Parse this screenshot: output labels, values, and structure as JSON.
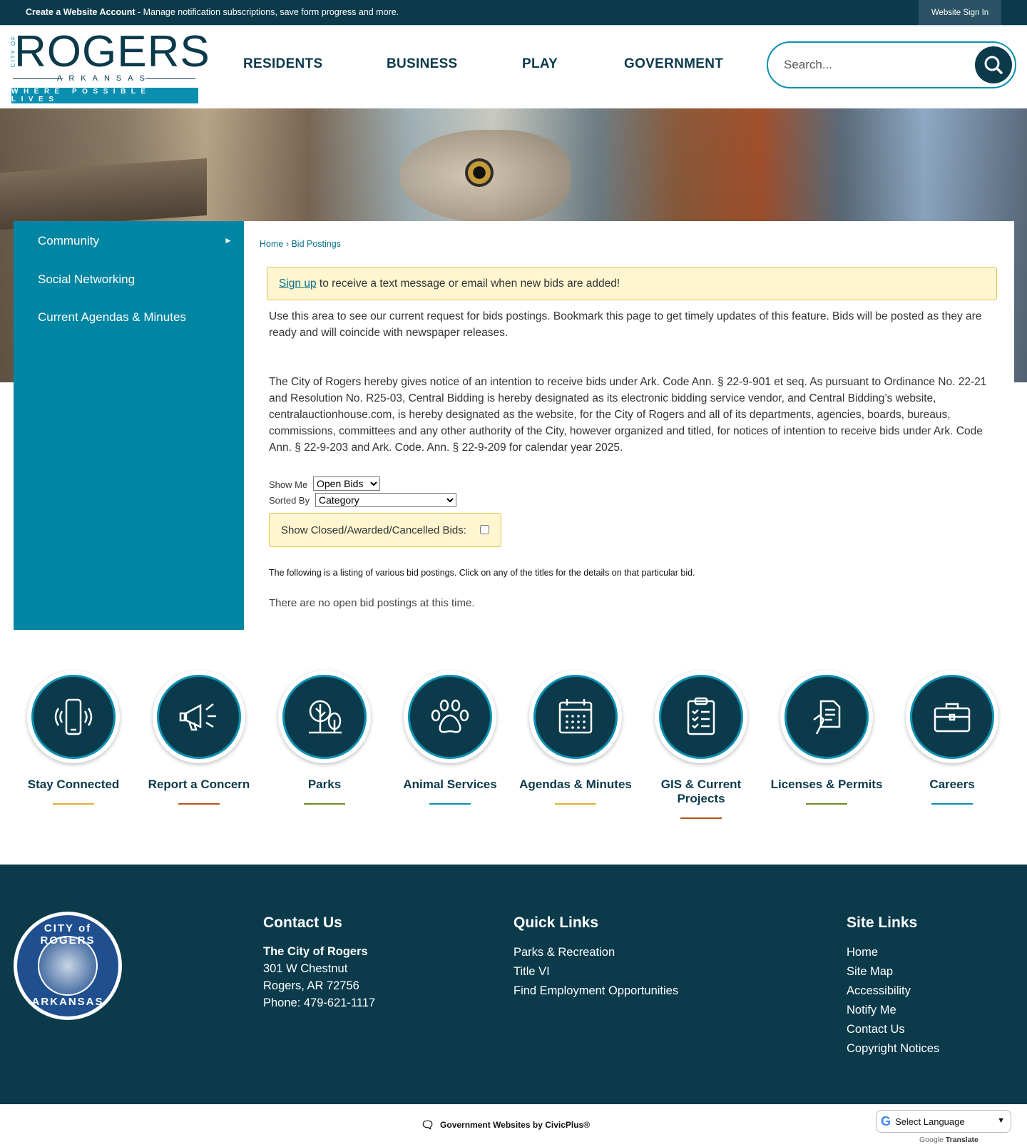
{
  "topbar": {
    "account_link": "Create a Website Account",
    "account_desc": " - Manage notification subscriptions, save form progress and more.",
    "signin": "Website Sign In"
  },
  "logo": {
    "city_of": "CITY OF",
    "name": "ROGERS",
    "state": "ARKANSAS",
    "tagline": "WHERE POSSIBLE LIVES"
  },
  "nav": {
    "items": [
      "RESIDENTS",
      "BUSINESS",
      "PLAY",
      "GOVERNMENT"
    ]
  },
  "search": {
    "placeholder": "Search..."
  },
  "sidebar": {
    "items": [
      "Community",
      "Social Networking",
      "Current Agendas & Minutes"
    ]
  },
  "breadcrumb": {
    "home": "Home",
    "sep": " › ",
    "current": "Bid Postings"
  },
  "notice": {
    "link": "Sign up",
    "text": " to receive a text message or email when new bids are added!"
  },
  "intro": "Use this area to see our current request for bids postings. Bookmark this page to get timely updates of this feature. Bids will be posted as they are ready and will coincide with newspaper releases.",
  "legal": "The City of Rogers hereby gives notice of an intention to receive bids under Ark. Code Ann. § 22-9-901 et seq. As pursuant to Ordinance No. 22-21 and Resolution No. R25-03, Central Bidding is hereby designated as its electronic bidding service vendor, and Central Bidding’s website, centralauctionhouse.com, is hereby designated as the website, for the City of Rogers and all of its departments, agencies, boards, bureaus, commissions, committees and any other authority of the City, however organized and titled, for notices of intention to receive bids under Ark. Code Ann. § 22-9-203 and Ark. Code. Ann. § 22-9-209 for calendar year 2025.",
  "filters": {
    "show_me_label": "Show Me",
    "show_me_value": "Open Bids",
    "sorted_by_label": "Sorted By",
    "sorted_by_value": "Category",
    "closed_label": "Show Closed/Awarded/Cancelled Bids:"
  },
  "listing_note": "The following is a listing of various bid postings. Click on any of the titles for the details on that particular bid.",
  "no_bids": "There are no open bid postings at this time.",
  "quick_links": [
    {
      "label": "Stay Connected",
      "icon": "mobile-phone-icon",
      "color": "#e0b32a"
    },
    {
      "label": "Report a Concern",
      "icon": "megaphone-icon",
      "color": "#b5531f"
    },
    {
      "label": "Parks",
      "icon": "trees-icon",
      "color": "#6b8e23"
    },
    {
      "label": "Animal Services",
      "icon": "paw-icon",
      "color": "#0b8fb0"
    },
    {
      "label": "Agendas & Minutes",
      "icon": "calendar-icon",
      "color": "#e0b32a"
    },
    {
      "label": "GIS & Current Projects",
      "icon": "clipboard-checklist-icon",
      "color": "#b5531f"
    },
    {
      "label": "Licenses & Permits",
      "icon": "document-hand-icon",
      "color": "#6b8e23"
    },
    {
      "label": "Careers",
      "icon": "briefcase-icon",
      "color": "#0b8fb0"
    }
  ],
  "footer": {
    "seal_top": "CITY of ROGERS",
    "seal_bottom": "ARKANSAS",
    "contact": {
      "heading": "Contact Us",
      "org": "The City of Rogers",
      "address1": "301 W Chestnut",
      "address2": "Rogers, AR 72756",
      "phone": "Phone: 479-621-1117"
    },
    "quick": {
      "heading": "Quick Links",
      "links": [
        "Parks & Recreation",
        "Title VI",
        "Find Employment Opportunities"
      ]
    },
    "site": {
      "heading": "Site Links",
      "links": [
        "Home",
        "Site Map",
        "Accessibility",
        "Notify Me",
        "Contact Us",
        "Copyright Notices"
      ]
    }
  },
  "bottom": {
    "civicplus": "Government Websites by CivicPlus®",
    "language": "Select Language",
    "powered_by": "Google",
    "translate": "Translate"
  },
  "colors": {
    "dark_teal": "#0b3a4b",
    "accent_blue": "#0b8fb0",
    "sidebar": "#0085a3",
    "notice_bg": "#fdf6d1"
  }
}
